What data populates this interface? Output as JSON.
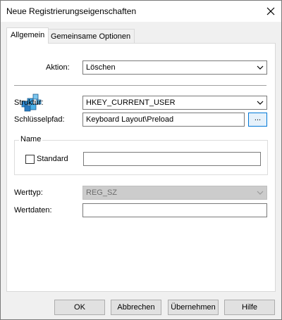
{
  "window": {
    "title": "Neue Registrierungseigenschaften"
  },
  "tabs": [
    {
      "label": "Allgemein",
      "active": true
    },
    {
      "label": "Gemeinsame Optionen",
      "active": false
    }
  ],
  "general": {
    "icon": "registry-icon",
    "action": {
      "label": "Aktion:",
      "value": "Löschen"
    },
    "hive": {
      "label": "Struktur:",
      "value": "HKEY_CURRENT_USER"
    },
    "key_path": {
      "label": "Schlüsselpfad:",
      "value": "Keyboard Layout\\Preload",
      "browse_label": "..."
    },
    "name_group": {
      "title": "Name",
      "default_checkbox_label": "Standard",
      "default_checked": false,
      "name_value": ""
    },
    "value_type": {
      "label": "Werttyp:",
      "value": "REG_SZ",
      "disabled": true
    },
    "value_data": {
      "label": "Wertdaten:",
      "value": ""
    }
  },
  "buttons": {
    "ok": "OK",
    "cancel": "Abbrechen",
    "apply": "Übernehmen",
    "help": "Hilfe"
  },
  "colors": {
    "accent": "#0078d7",
    "disabled_fill": "#cccccc"
  }
}
